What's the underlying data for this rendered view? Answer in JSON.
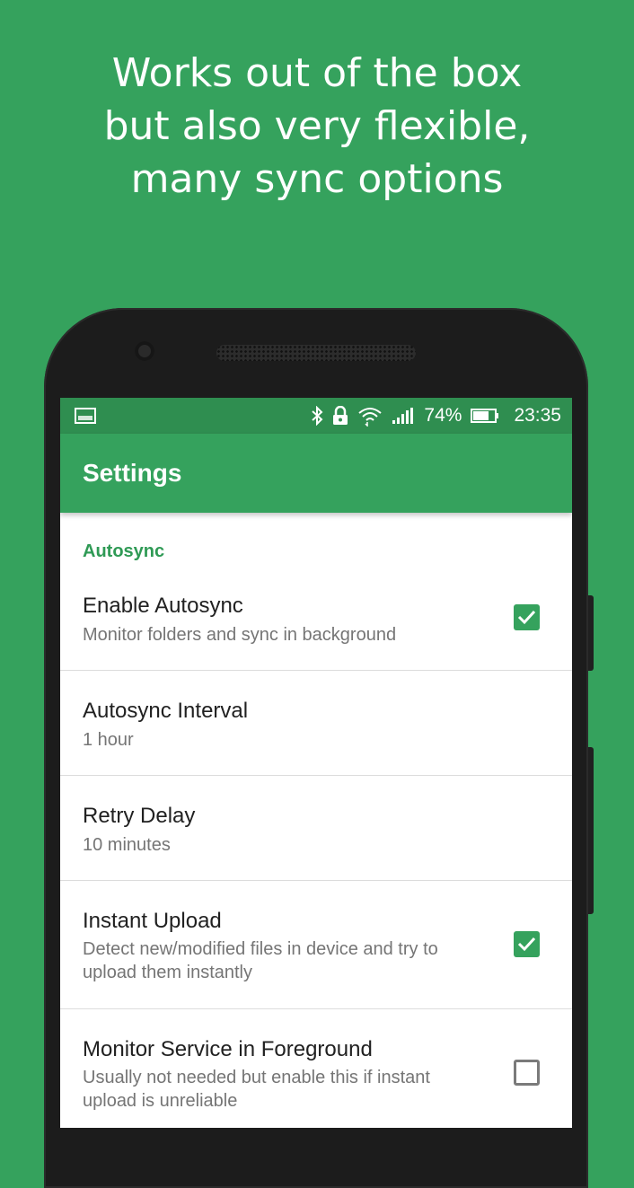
{
  "headline": {
    "lines": [
      "Works out of the box",
      "but also very flexible,",
      "many sync options"
    ]
  },
  "statusbar": {
    "left_icon": "notification-image-icon",
    "icons": [
      "bluetooth-icon",
      "lock-icon",
      "wifi-icon",
      "signal-icon"
    ],
    "battery_percent": "74%",
    "battery_level": 0.74,
    "time": "23:35"
  },
  "toolbar": {
    "title": "Settings"
  },
  "colors": {
    "primary": "#35a25d",
    "status_bar": "#2f8e50",
    "accent": "#35a25d"
  },
  "settings": {
    "section_header": "Autosync",
    "items": [
      {
        "title": "Enable Autosync",
        "summary": "Monitor folders and sync in background",
        "checkbox": true
      },
      {
        "title": "Autosync Interval",
        "summary": "1 hour"
      },
      {
        "title": "Retry Delay",
        "summary": "10 minutes"
      },
      {
        "title": "Instant Upload",
        "summary": "Detect new/modified files in device and try to upload them instantly",
        "checkbox": true
      },
      {
        "title": "Monitor Service in Foreground",
        "summary": "Usually not needed but enable this if instant upload is unreliable",
        "checkbox": false
      }
    ]
  }
}
